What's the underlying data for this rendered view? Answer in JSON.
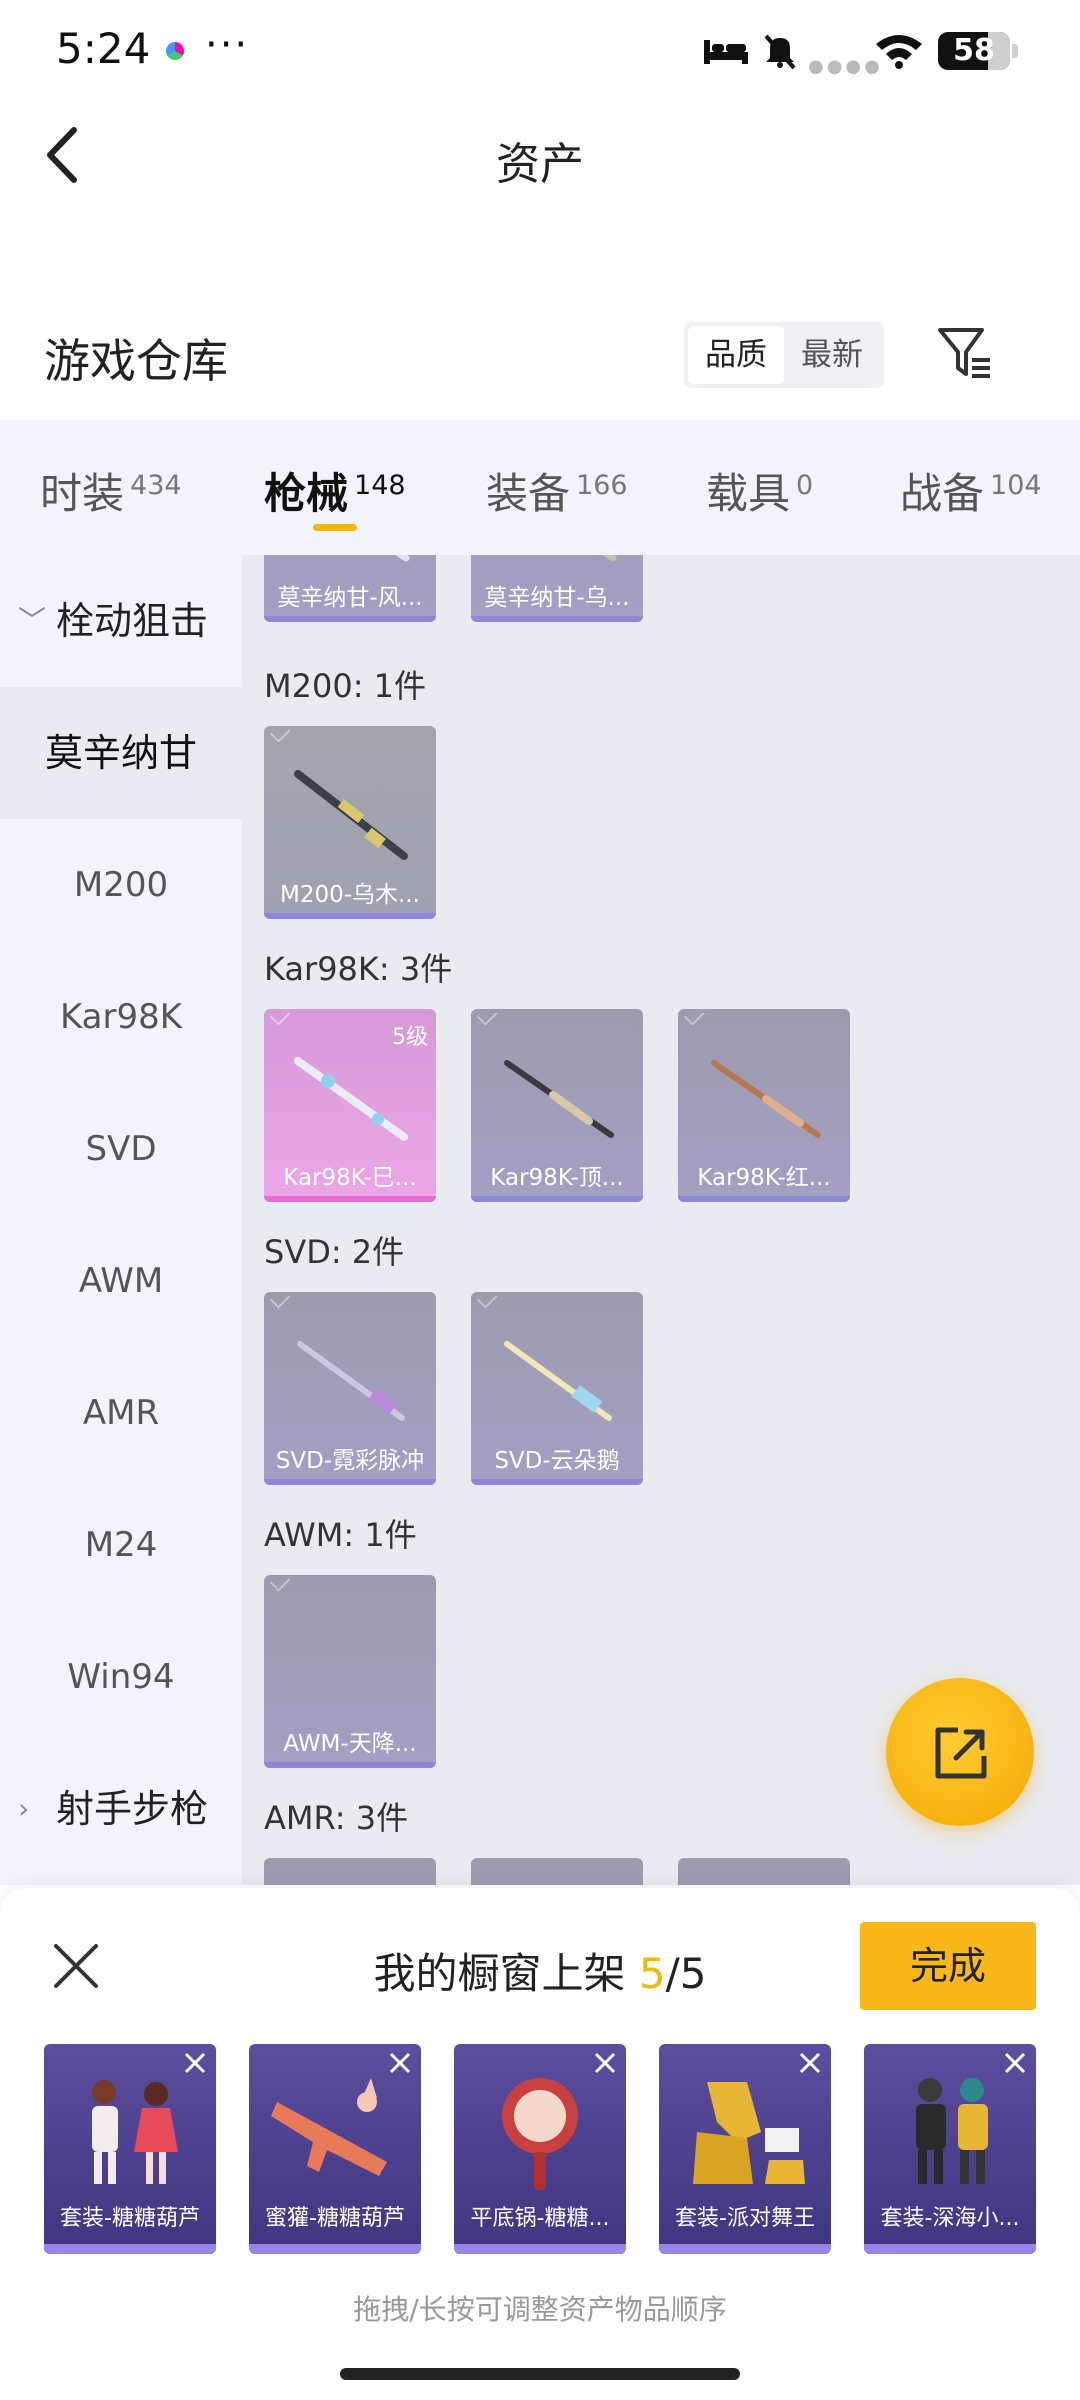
{
  "status_bar": {
    "time": "5:24",
    "more": "···",
    "battery": "58"
  },
  "header": {
    "title": "资产",
    "back_icon": "chevron-left-icon"
  },
  "warehouse": {
    "title": "游戏仓库",
    "sort_options": [
      "品质",
      "最新"
    ],
    "sort_active": "品质",
    "filter_icon": "filter-icon"
  },
  "tabs": [
    {
      "label": "时装",
      "count": "434"
    },
    {
      "label": "枪械",
      "count": "148",
      "active": true
    },
    {
      "label": "装备",
      "count": "166"
    },
    {
      "label": "载具",
      "count": "0"
    },
    {
      "label": "战备",
      "count": "104"
    }
  ],
  "sidebar": {
    "items": [
      {
        "label": "栓动狙击",
        "type": "group",
        "chevron": "chevron-down-icon"
      },
      {
        "label": "莫辛纳甘",
        "selected": true
      },
      {
        "label": "M200"
      },
      {
        "label": "Kar98K"
      },
      {
        "label": "SVD"
      },
      {
        "label": "AWM"
      },
      {
        "label": "AMR"
      },
      {
        "label": "M24"
      },
      {
        "label": "Win94"
      },
      {
        "label": "射手步枪",
        "type": "group",
        "chevron": "chevron-right-icon"
      }
    ]
  },
  "content": {
    "top_partial_items": [
      "莫辛纳甘-风...",
      "莫辛纳甘-乌..."
    ],
    "groups": [
      {
        "title": "M200: 1件",
        "items": [
          {
            "name": "M200-乌木...",
            "style": "grey"
          }
        ]
      },
      {
        "title": "Kar98K: 3件",
        "items": [
          {
            "name": "Kar98K-巳...",
            "style": "pink",
            "level": "5级"
          },
          {
            "name": "Kar98K-顶...",
            "style": "purple"
          },
          {
            "name": "Kar98K-红...",
            "style": "purple"
          }
        ]
      },
      {
        "title": "SVD: 2件",
        "items": [
          {
            "name": "SVD-霓彩脉冲",
            "style": "purple"
          },
          {
            "name": "SVD-云朵鹅",
            "style": "purple"
          }
        ]
      },
      {
        "title": "AWM: 1件",
        "items": [
          {
            "name": "AWM-天降...",
            "style": "purple"
          }
        ]
      },
      {
        "title": "AMR: 3件",
        "items": []
      }
    ],
    "share_icon": "share-icon"
  },
  "showcase": {
    "title_prefix": "我的橱窗上架 ",
    "current": "5",
    "total": "/5",
    "done_label": "完成",
    "close_icon": "close-icon",
    "items": [
      {
        "name": "套装-糖糖葫芦"
      },
      {
        "name": "蜜獾-糖糖葫芦"
      },
      {
        "name": "平底锅-糖糖..."
      },
      {
        "name": "套装-派对舞王"
      },
      {
        "name": "套装-深海小..."
      }
    ],
    "hint": "拖拽/长按可调整资产物品顺序"
  }
}
